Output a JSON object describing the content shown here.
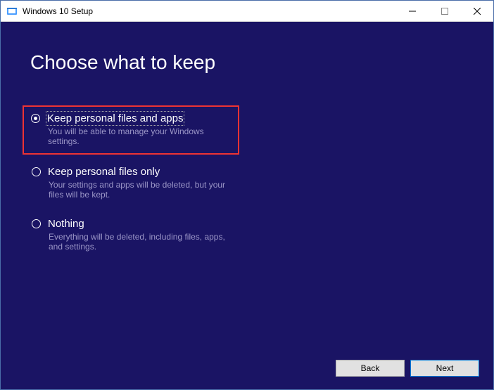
{
  "titlebar": {
    "title": "Windows 10 Setup"
  },
  "heading": "Choose what to keep",
  "options": [
    {
      "label": "Keep personal files and apps",
      "desc": "You will be able to manage your Windows settings.",
      "checked": true,
      "highlighted": true
    },
    {
      "label": "Keep personal files only",
      "desc": "Your settings and apps will be deleted, but your files will be kept.",
      "checked": false,
      "highlighted": false
    },
    {
      "label": "Nothing",
      "desc": "Everything will be deleted, including files, apps, and settings.",
      "checked": false,
      "highlighted": false
    }
  ],
  "buttons": {
    "back": "Back",
    "next": "Next"
  }
}
